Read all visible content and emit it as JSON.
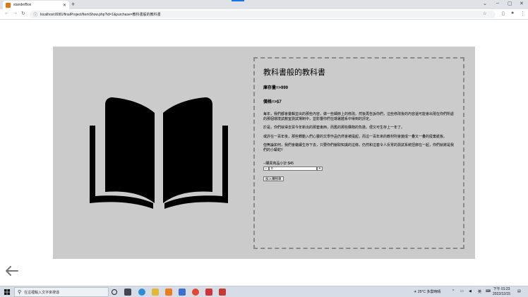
{
  "browser": {
    "tab_title": "standerBox",
    "tab_close": "✕",
    "new_tab": "+",
    "url_host": "localhost:8081",
    "url_path": "/finalProject/ItemShow.php?id=1&purchase=教科書般的教科書"
  },
  "product": {
    "title": "教科書般的教科書",
    "stock": "庫存量=>999",
    "price": "價格=>$7",
    "paragraphs": [
      "每年，我們都會彙輯並出的那些內容，做一些細節上的修改。然後再告訴你們，這些修改後的內容還可能會出現在你們所處的那個環境試教室測試場制中，並影響你們在環署體系中得到的評定。",
      "於是，你們就得去買今年新出的那套東西，而舊的那些購物的負擔，便又可生存上一年了。",
      "或許在一百年後，那些轉動入們心靈的文學作品仍然會被提起，而這一百年來的教材則會變成一疊又一疊的廢棄紙板。",
      "但無論如何，我們會繼續生存下去，只要你們僱取知識的這條，仍然和這套令人反胃的測試系統扭綁在一起，你們就將是我們的小蟒蛇!!"
    ],
    "purchase_hint": "--購買商品小計:$45",
    "quantity_value": "0",
    "minus_label": "-",
    "plus_label": "+",
    "add_to_cart_label": "加入購物車"
  },
  "taskbar": {
    "search_placeholder": "在這裡輸入文字來搜尋",
    "weather": "25°C 多雲時晴",
    "ime": "英",
    "time": "下午 01:23",
    "date": "2022/12/15"
  },
  "colors": {
    "panel_bg": "#cbcbcb",
    "book_fill": "#000000",
    "tab_accent": "#1a73e8"
  },
  "icons": [
    "book-icon",
    "back-arrow-icon",
    "search-icon",
    "windows-start-icon",
    "lock-icon"
  ]
}
